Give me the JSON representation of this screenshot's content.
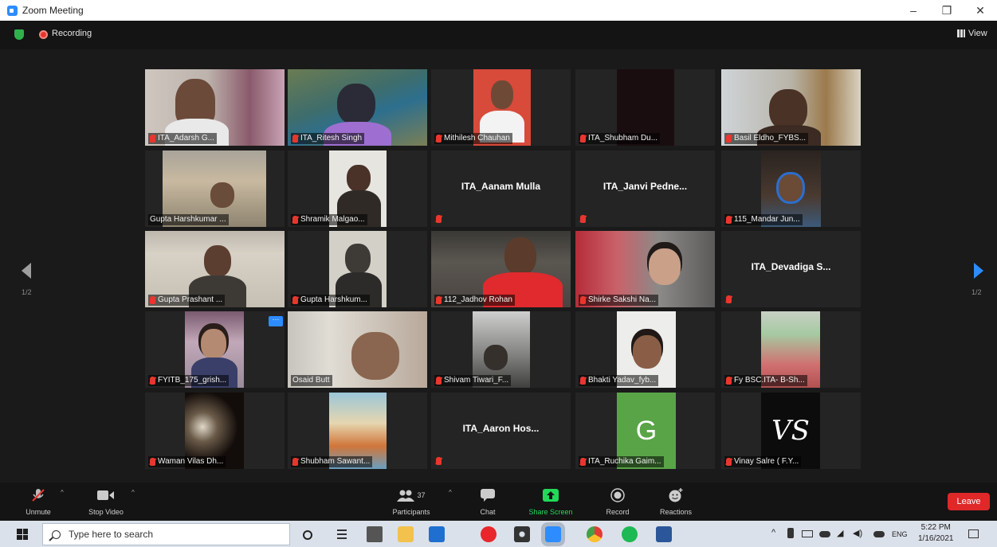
{
  "window": {
    "title": "Zoom Meeting"
  },
  "status": {
    "recording_label": "Recording",
    "view_label": "View"
  },
  "pager": {
    "left": "1/2",
    "right": "1/2"
  },
  "tiles": [
    {
      "name": "ITA_Adarsh G...",
      "mic": true,
      "video": true
    },
    {
      "name": "ITA_Ritesh Singh",
      "mic": true,
      "video": true,
      "active": true
    },
    {
      "name": "Mithilesh Chauhan",
      "mic": true,
      "video": true
    },
    {
      "name": "ITA_Shubham Du...",
      "mic": true,
      "video": true
    },
    {
      "name": "Basil Eldho_FYBS...",
      "mic": true,
      "video": true
    },
    {
      "name": "Gupta Harshkumar ...",
      "mic": false,
      "video": true
    },
    {
      "name": "Shramik Malgao...",
      "mic": true,
      "video": true
    },
    {
      "name": "ITA_Aanam Mulla",
      "mic": true,
      "video": false
    },
    {
      "name": "ITA_Janvi  Pedne...",
      "mic": true,
      "video": false
    },
    {
      "name": "115_Mandar Jun...",
      "mic": true,
      "video": true
    },
    {
      "name": "Gupta Prashant ...",
      "mic": true,
      "video": true
    },
    {
      "name": "Gupta Harshkum...",
      "mic": true,
      "video": true
    },
    {
      "name": "112_Jadhov Rohan",
      "mic": true,
      "video": true
    },
    {
      "name": "Shirke Sakshi Na...",
      "mic": true,
      "video": true
    },
    {
      "name": "ITA_Devadiga S...",
      "mic": true,
      "video": false
    },
    {
      "name": "FYITB_175_grish...",
      "mic": true,
      "video": true,
      "more": "···"
    },
    {
      "name": "Osaid Butt",
      "mic": false,
      "video": true
    },
    {
      "name": "Shivam Tiwari_F...",
      "mic": true,
      "video": true
    },
    {
      "name": "Bhakti Yadav_fyb...",
      "mic": true,
      "video": true
    },
    {
      "name": "Fy BSC.ITA- B-Sh...",
      "mic": true,
      "video": true
    },
    {
      "name": "Waman Vilas Dh...",
      "mic": true,
      "video": true
    },
    {
      "name": "Shubham Sawant...",
      "mic": true,
      "video": true
    },
    {
      "name": "ITA_Aaron Hos...",
      "mic": true,
      "video": false
    },
    {
      "name": "ITA_Ruchika Gaim...",
      "mic": true,
      "video": true,
      "avatar_letter": "G"
    },
    {
      "name": "Vinay Salre ( F.Y...",
      "mic": true,
      "video": true,
      "avatar_letter": "VS"
    }
  ],
  "toolbar": {
    "unmute": "Unmute",
    "stop_video": "Stop Video",
    "participants": "Participants",
    "participant_count": "37",
    "chat": "Chat",
    "share_screen": "Share Screen",
    "record": "Record",
    "reactions": "Reactions",
    "leave": "Leave"
  },
  "taskbar": {
    "search_placeholder": "Type here to search",
    "lang": "ENG",
    "time": "5:22 PM",
    "date": "1/16/2021"
  },
  "colors": {
    "accent": "#2d8cff",
    "leave": "#e02828",
    "active_speaker": "#e6e047",
    "share": "#23d959"
  }
}
